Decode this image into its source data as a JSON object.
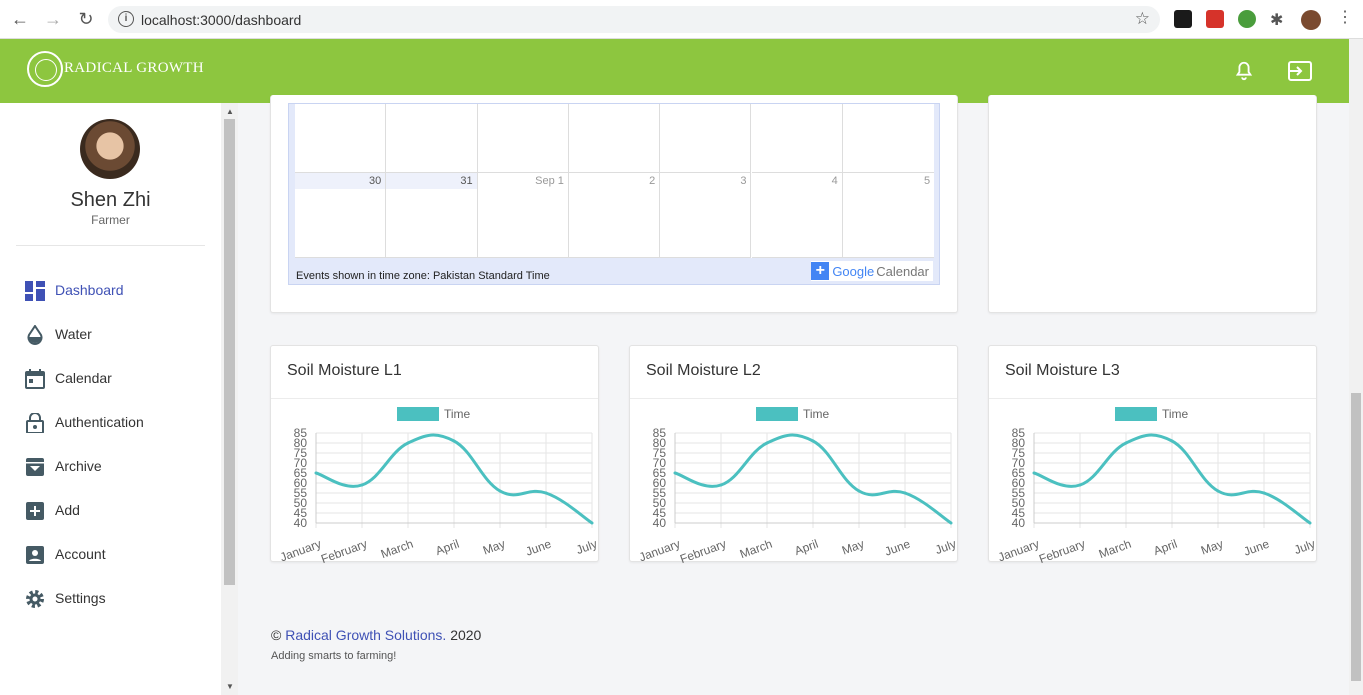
{
  "browser": {
    "url": "localhost:3000/dashboard",
    "info_icon": "info-icon",
    "star_icon": "star-icon"
  },
  "header": {
    "brand": "RADICAL GROWTH",
    "accent": "#8dc63f",
    "icons": [
      "bell-icon",
      "logout-icon"
    ]
  },
  "user": {
    "name": "Shen Zhi",
    "role": "Farmer"
  },
  "sidebar": {
    "items": [
      {
        "label": "Dashboard",
        "icon": "dashboard-icon",
        "active": true
      },
      {
        "label": "Water",
        "icon": "water-drop-icon"
      },
      {
        "label": "Calendar",
        "icon": "calendar-icon"
      },
      {
        "label": "Authentication",
        "icon": "lock-icon"
      },
      {
        "label": "Archive",
        "icon": "archive-icon"
      },
      {
        "label": "Add",
        "icon": "add-box-icon"
      },
      {
        "label": "Account",
        "icon": "account-box-icon"
      },
      {
        "label": "Settings",
        "icon": "gear-icon"
      }
    ]
  },
  "calendar": {
    "dates": [
      "30",
      "31",
      "Sep 1",
      "2",
      "3",
      "4",
      "5"
    ],
    "timezone_note": "Events shown in time zone: Pakistan Standard Time",
    "google": "Google",
    "calendar_word": "Calendar"
  },
  "chart_data": [
    {
      "type": "line",
      "title": "Soil Moisture L1",
      "categories": [
        "January",
        "February",
        "March",
        "April",
        "May",
        "June",
        "July"
      ],
      "series": [
        {
          "name": "Time",
          "values": [
            65,
            59,
            80,
            81,
            56,
            55,
            40
          ],
          "color": "#4bc0c0"
        }
      ],
      "yticks": [
        85,
        80,
        75,
        70,
        65,
        60,
        55,
        50,
        45,
        40
      ],
      "ylim": [
        40,
        85
      ],
      "legend": "top"
    },
    {
      "type": "line",
      "title": "Soil Moisture L2",
      "categories": [
        "January",
        "February",
        "March",
        "April",
        "May",
        "June",
        "July"
      ],
      "series": [
        {
          "name": "Time",
          "values": [
            65,
            59,
            80,
            81,
            56,
            55,
            40
          ],
          "color": "#4bc0c0"
        }
      ],
      "yticks": [
        85,
        80,
        75,
        70,
        65,
        60,
        55,
        50,
        45,
        40
      ],
      "ylim": [
        40,
        85
      ],
      "legend": "top"
    },
    {
      "type": "line",
      "title": "Soil Moisture L3",
      "categories": [
        "January",
        "February",
        "March",
        "April",
        "May",
        "June",
        "July"
      ],
      "series": [
        {
          "name": "Time",
          "values": [
            65,
            59,
            80,
            81,
            56,
            55,
            40
          ],
          "color": "#4bc0c0"
        }
      ],
      "yticks": [
        85,
        80,
        75,
        70,
        65,
        60,
        55,
        50,
        45,
        40
      ],
      "ylim": [
        40,
        85
      ],
      "legend": "top"
    }
  ],
  "footer": {
    "copyright_symbol": "©",
    "company": "Radical Growth Solutions.",
    "year": "2020",
    "tagline": "Adding smarts to farming!"
  }
}
